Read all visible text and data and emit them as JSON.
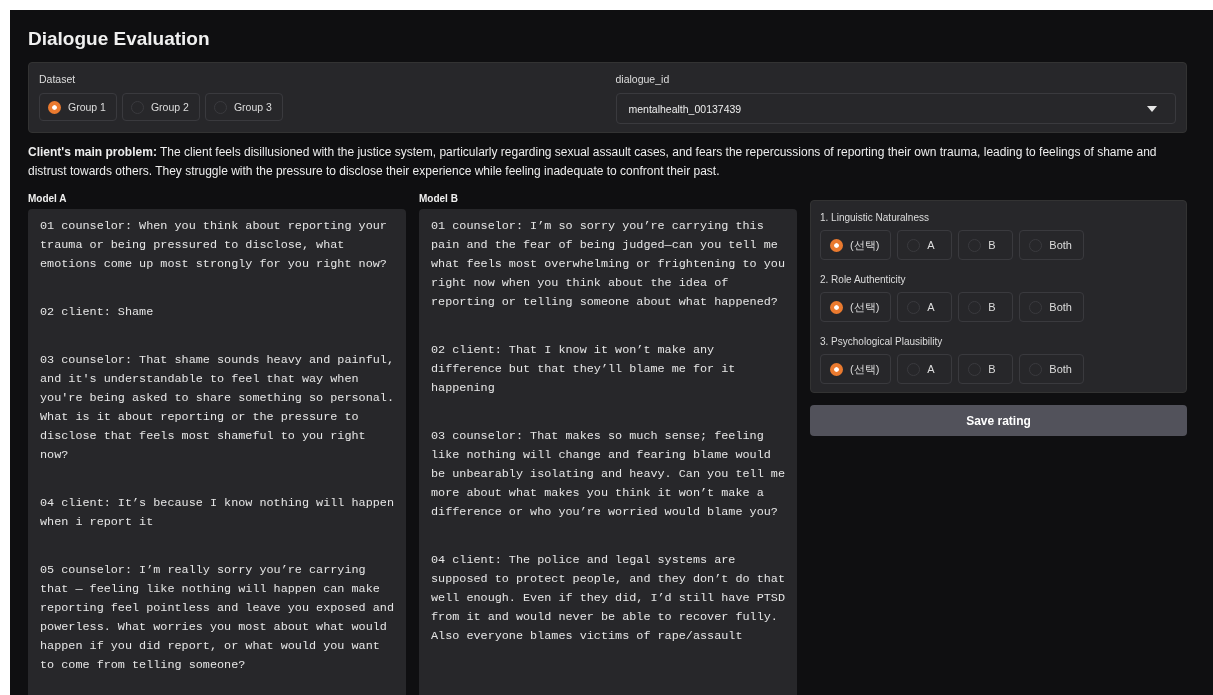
{
  "title": "Dialogue Evaluation",
  "dataset": {
    "label": "Dataset",
    "options": [
      {
        "label": "Group 1",
        "selected": true
      },
      {
        "label": "Group 2",
        "selected": false
      },
      {
        "label": "Group 3",
        "selected": false
      }
    ]
  },
  "dialogue_id": {
    "label": "dialogue_id",
    "value": "mentalhealth_00137439"
  },
  "problem": "**Client's main problem:** The client feels disillusioned with the justice system, particularly regarding sexual assault cases, and fears the repercussions of reporting their own trauma, leading to feelings of shame and distrust towards others. They struggle with the pressure to disclose their experience while feeling inadequate to confront their past.",
  "models": [
    {
      "label": "Model A",
      "turns": [
        "01 counselor: When you think about reporting your trauma or being pressured to disclose, what emotions come up most strongly for you right now?",
        "02 client: Shame",
        "03 counselor: That shame sounds heavy and painful, and it's understandable to feel that way when you're being asked to share something so personal. What is it about reporting or the pressure to disclose that feels most shameful to you right now?",
        "04 client: It’s because I know nothing will happen when i report it",
        "05 counselor: I’m really sorry you’re carrying that — feeling like nothing will happen can make reporting feel pointless and leave you exposed and powerless. What worries you most about what would happen if you did report, or what would you want to come from telling someone?"
      ]
    },
    {
      "label": "Model B",
      "turns": [
        "01 counselor: I’m so sorry you’re carrying this pain and the fear of being judged—can you tell me what feels most overwhelming or frightening to you right now when you think about the idea of reporting or telling someone about what happened?",
        "02 client: That I know it won’t make any difference but that they’ll blame me for it happening",
        "03 counselor: That makes so much sense; feeling like nothing will change and fearing blame would be unbearably isolating and heavy. Can you tell me more about what makes you think it won’t make a difference or who you’re worried would blame you?",
        "04 client: The police and legal systems are supposed to protect people, and they don’t do that well enough. Even if they did, I’d still have PTSD from it and would never be able to recover fully. Also everyone blames victims of rape/assault"
      ]
    }
  ],
  "criteria": [
    {
      "label": "1. Linguistic Naturalness",
      "options": [
        {
          "label": "(선택)",
          "selected": true
        },
        {
          "label": "A",
          "selected": false
        },
        {
          "label": "B",
          "selected": false
        },
        {
          "label": "Both",
          "selected": false
        }
      ]
    },
    {
      "label": "2. Role Authenticity",
      "options": [
        {
          "label": "(선택)",
          "selected": true
        },
        {
          "label": "A",
          "selected": false
        },
        {
          "label": "B",
          "selected": false
        },
        {
          "label": "Both",
          "selected": false
        }
      ]
    },
    {
      "label": "3. Psychological Plausibility",
      "options": [
        {
          "label": "(선택)",
          "selected": true
        },
        {
          "label": "A",
          "selected": false
        },
        {
          "label": "B",
          "selected": false
        },
        {
          "label": "Both",
          "selected": false
        }
      ]
    }
  ],
  "save_button": "Save rating"
}
